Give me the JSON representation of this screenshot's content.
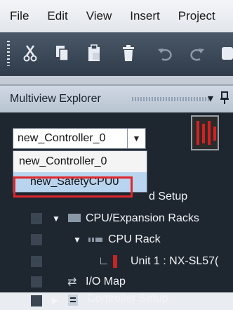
{
  "menu": [
    "File",
    "Edit",
    "View",
    "Insert",
    "Project"
  ],
  "explorer": {
    "title": "Multiview Explorer",
    "pin_icon": "pin-icon",
    "dropdown_icon": "dropdown-icon"
  },
  "combo": {
    "value": "new_Controller_0"
  },
  "dropdown_options": [
    "new_Controller_0",
    "new_SafetyCPU0"
  ],
  "tree": {
    "item_partial": "d Setup",
    "item_racks": "CPU/Expansion Racks",
    "item_cpu_rack": "CPU Rack",
    "item_unit": "Unit 1 : NX-SL57(",
    "item_io": "I/O Map",
    "item_controller_setup": "Controller Setup"
  },
  "colors": {
    "highlight": "#e0262b",
    "toolbar": "#3a4757",
    "tree_bg": "#1e2630"
  }
}
